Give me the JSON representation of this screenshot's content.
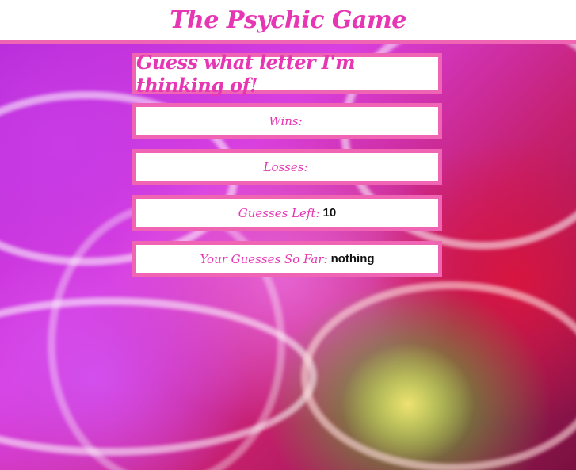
{
  "header": {
    "title": "The Psychic Game"
  },
  "game": {
    "heading": "Guess what letter I'm thinking of!",
    "wins": {
      "label": "Wins:",
      "value": ""
    },
    "losses": {
      "label": "Losses:",
      "value": ""
    },
    "guesses_left": {
      "label": "Guesses Left:",
      "value": "10"
    },
    "guesses_so_far": {
      "label": "Your Guesses So Far:",
      "value": "nothing"
    }
  },
  "colors": {
    "accent": "#e636b4",
    "border": "#f064b4",
    "value_text": "#111111"
  }
}
